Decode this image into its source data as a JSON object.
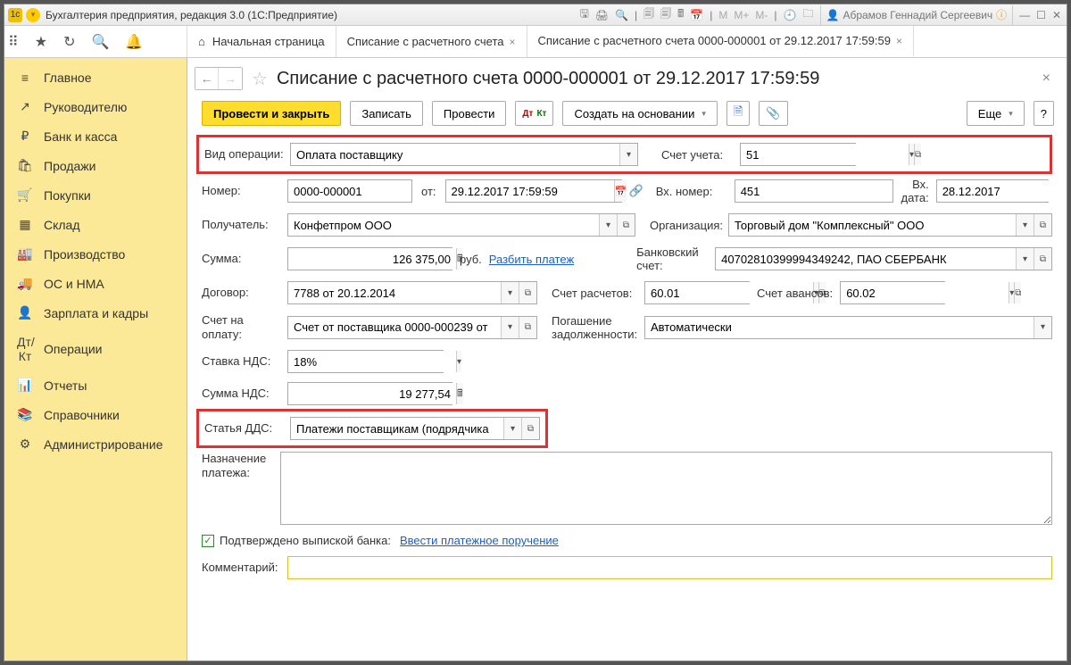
{
  "titlebar": {
    "title": "Бухгалтерия предприятия, редакция 3.0  (1С:Предприятие)",
    "user": "Абрамов Геннадий Сергеевич"
  },
  "tabs": {
    "home": "Начальная страница",
    "t1": "Списание с расчетного счета",
    "t2": "Списание с расчетного счета 0000-000001 от 29.12.2017 17:59:59"
  },
  "sidebar": {
    "items": [
      {
        "icon": "≡",
        "label": "Главное"
      },
      {
        "icon": "↗",
        "label": "Руководителю"
      },
      {
        "icon": "₽",
        "label": "Банк и касса"
      },
      {
        "icon": "🛍",
        "label": "Продажи"
      },
      {
        "icon": "🛒",
        "label": "Покупки"
      },
      {
        "icon": "▦",
        "label": "Склад"
      },
      {
        "icon": "🏭",
        "label": "Производство"
      },
      {
        "icon": "🚚",
        "label": "ОС и НМА"
      },
      {
        "icon": "👤",
        "label": "Зарплата и кадры"
      },
      {
        "icon": "Дт/Кт",
        "label": "Операции"
      },
      {
        "icon": "📊",
        "label": "Отчеты"
      },
      {
        "icon": "📚",
        "label": "Справочники"
      },
      {
        "icon": "⚙",
        "label": "Администрирование"
      }
    ]
  },
  "doc": {
    "title": "Списание с расчетного счета 0000-000001 от 29.12.2017 17:59:59",
    "actions": {
      "post_close": "Провести и закрыть",
      "record": "Записать",
      "post": "Провести",
      "create_based": "Создать на основании",
      "more": "Еще",
      "help": "?"
    },
    "labels": {
      "op_kind": "Вид операции:",
      "account": "Счет учета:",
      "number": "Номер:",
      "from": "от:",
      "in_number": "Вх. номер:",
      "in_date": "Вх. дата:",
      "recipient": "Получатель:",
      "org": "Организация:",
      "amount": "Сумма:",
      "rub": "руб.",
      "split": "Разбить платеж",
      "bank_acc": "Банковский счет:",
      "contract": "Договор:",
      "acc_settl": "Счет расчетов:",
      "acc_adv": "Счет авансов:",
      "invoice": "Счет на оплату:",
      "debt": "Погашение задолженности:",
      "vat_rate": "Ставка НДС:",
      "vat_sum": "Сумма НДС:",
      "dds": "Статья ДДС:",
      "purpose": "Назначение платежа:",
      "confirmed": "Подтверждено выпиской банка:",
      "make_pp": "Ввести платежное поручение",
      "comment": "Комментарий:"
    },
    "values": {
      "op_kind": "Оплата поставщику",
      "account": "51",
      "number": "0000-000001",
      "date": "29.12.2017 17:59:59",
      "in_number": "451",
      "in_date": "28.12.2017",
      "recipient": "Конфетпром ООО",
      "org": "Торговый дом \"Комплексный\" ООО",
      "amount": "126 375,00",
      "bank_acc": "40702810399994349242, ПАО СБЕРБАНК",
      "contract": "7788 от 20.12.2014",
      "acc_settl": "60.01",
      "acc_adv": "60.02",
      "invoice": "Счет от поставщика 0000-000239 от",
      "debt": "Автоматически",
      "vat_rate": "18%",
      "vat_sum": "19 277,54",
      "dds": "Платежи поставщикам (подрядчика"
    }
  }
}
